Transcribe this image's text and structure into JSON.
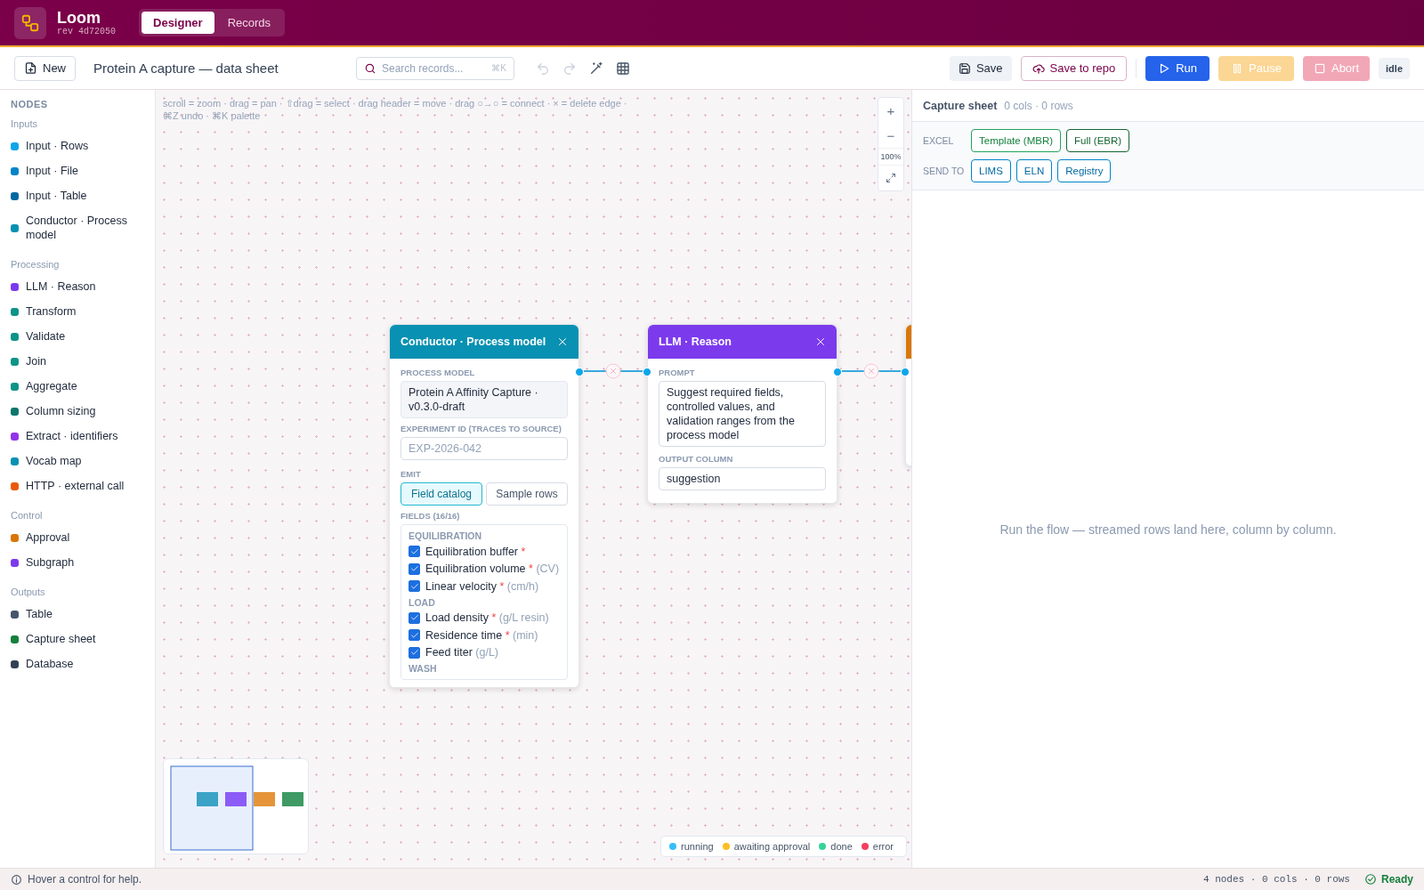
{
  "app": {
    "name": "Loom",
    "revision": "rev 4d72050"
  },
  "tabs": [
    {
      "label": "Designer",
      "selected": true
    },
    {
      "label": "Records",
      "selected": false
    }
  ],
  "toolbar": {
    "new_button": "New",
    "title": "Protein A capture — data sheet",
    "search": {
      "placeholder": "Search records...",
      "shortcut": "⌘K"
    },
    "tools": [
      {
        "kind": "undo",
        "disabled": true
      },
      {
        "kind": "redo",
        "disabled": true
      },
      {
        "kind": "wand",
        "disabled": false
      },
      {
        "kind": "grid",
        "disabled": false
      }
    ],
    "actions": [
      {
        "kind": "save",
        "label": "Save"
      },
      {
        "kind": "repo",
        "label": "Save to repo"
      },
      {
        "kind": "run",
        "label": "Run",
        "disabled": false
      },
      {
        "kind": "pause",
        "label": "Pause",
        "disabled": true
      },
      {
        "kind": "abort",
        "label": "Abort",
        "disabled": true
      }
    ],
    "status_badge": "idle"
  },
  "sidebar": {
    "heading": "NODES",
    "groups": [
      {
        "label": "Inputs",
        "items": [
          {
            "label": "Input · Rows",
            "color": "#0ea5e9"
          },
          {
            "label": "Input · File",
            "color": "#0284c7"
          },
          {
            "label": "Input · Table",
            "color": "#0369a1"
          },
          {
            "label": "Conductor · Process model",
            "color": "#0891b2"
          }
        ]
      },
      {
        "label": "Processing",
        "items": [
          {
            "label": "LLM · Reason",
            "color": "#7c3aed"
          },
          {
            "label": "Transform",
            "color": "#0d9488"
          },
          {
            "label": "Validate",
            "color": "#0d9488"
          },
          {
            "label": "Join",
            "color": "#0d9488"
          },
          {
            "label": "Aggregate",
            "color": "#0d9488"
          },
          {
            "label": "Column sizing",
            "color": "#0f766e"
          },
          {
            "label": "Extract · identifiers",
            "color": "#9333ea"
          },
          {
            "label": "Vocab map",
            "color": "#0891b2"
          },
          {
            "label": "HTTP · external call",
            "color": "#ea580c"
          }
        ]
      },
      {
        "label": "Control",
        "items": [
          {
            "label": "Approval",
            "color": "#d97706"
          },
          {
            "label": "Subgraph",
            "color": "#7c3aed"
          }
        ]
      },
      {
        "label": "Outputs",
        "items": [
          {
            "label": "Table",
            "color": "#475569"
          },
          {
            "label": "Capture sheet",
            "color": "#15803d"
          },
          {
            "label": "Database",
            "color": "#334155"
          }
        ]
      }
    ]
  },
  "canvas": {
    "hint": "scroll = zoom · drag = pan · ⇧drag = select · drag header = move · drag ○→○ = connect · × = delete edge · ⌘Z undo · ⌘K palette",
    "zoom": {
      "zoom_in": "+",
      "zoom_out": "−",
      "level_text": "100%"
    },
    "nodes": [
      {
        "title": "Conductor · Process model",
        "color": "#0891b2",
        "closable": true,
        "sections": [
          {
            "kind": "display",
            "label": "PROCESS MODEL",
            "value": "Protein A Affinity Capture · v0.3.0-draft"
          },
          {
            "kind": "input",
            "label": "EXPERIMENT ID (TRACES TO SOURCE)",
            "placeholder": "EXP-2026-042"
          },
          {
            "kind": "segmented",
            "label": "EMIT",
            "options": [
              {
                "label": "Field catalog",
                "selected": true
              },
              {
                "label": "Sample rows",
                "selected": false
              }
            ]
          },
          {
            "kind": "checklist",
            "label": "FIELDS (16/16)",
            "groups": [
              {
                "label": "EQUILIBRATION",
                "items": [
                  {
                    "label": "Equilibration buffer",
                    "mark": "*",
                    "checked": true
                  },
                  {
                    "label": "Equilibration volume",
                    "mark": "*",
                    "unit": "(CV)",
                    "checked": true
                  },
                  {
                    "label": "Linear velocity",
                    "mark": "*",
                    "unit": "(cm/h)",
                    "checked": true
                  }
                ]
              },
              {
                "label": "LOAD",
                "items": [
                  {
                    "label": "Load density",
                    "mark": "*",
                    "unit": "(g/L resin)",
                    "checked": true
                  },
                  {
                    "label": "Residence time",
                    "mark": "*",
                    "unit": "(min)",
                    "checked": true
                  },
                  {
                    "label": "Feed titer",
                    "unit": "(g/L)",
                    "checked": true
                  }
                ]
              },
              {
                "label": "WASH"
              }
            ]
          }
        ]
      },
      {
        "title": "LLM · Reason",
        "color": "#7c3aed",
        "closable": true,
        "sections": [
          {
            "kind": "textarea",
            "label": "PROMPT",
            "value": "Suggest required fields, controlled values, and validation ranges from the process model"
          },
          {
            "kind": "input",
            "label": "OUTPUT COLUMN",
            "value": "suggestion"
          }
        ]
      },
      {
        "color": "#d97706"
      }
    ],
    "minimap": {
      "nodes": [
        {
          "color": "#3aa3c6"
        },
        {
          "color": "#8b5cf6"
        },
        {
          "color": "#e5943a"
        },
        {
          "color": "#3f9a64"
        }
      ]
    },
    "legend": [
      {
        "label": "running",
        "color": "#38bdf8"
      },
      {
        "label": "awaiting approval",
        "color": "#fbbf24"
      },
      {
        "label": "done",
        "color": "#34d399"
      },
      {
        "label": "error",
        "color": "#f43f5e"
      }
    ]
  },
  "panel": {
    "title": "Capture sheet",
    "summary": "0 cols · 0 rows",
    "rows": [
      {
        "label": "EXCEL",
        "kind": "excel",
        "buttons": [
          "Template (MBR)",
          "Full (EBR)"
        ]
      },
      {
        "label": "SEND TO",
        "kind": "send",
        "buttons": [
          "LIMS",
          "ELN",
          "Registry"
        ]
      }
    ],
    "empty_message": "Run the flow — streamed rows land here, column by column."
  },
  "status_bar": {
    "help": "Hover a control for help.",
    "counts": "4 nodes · 0 cols · 0 rows",
    "state": "Ready"
  }
}
